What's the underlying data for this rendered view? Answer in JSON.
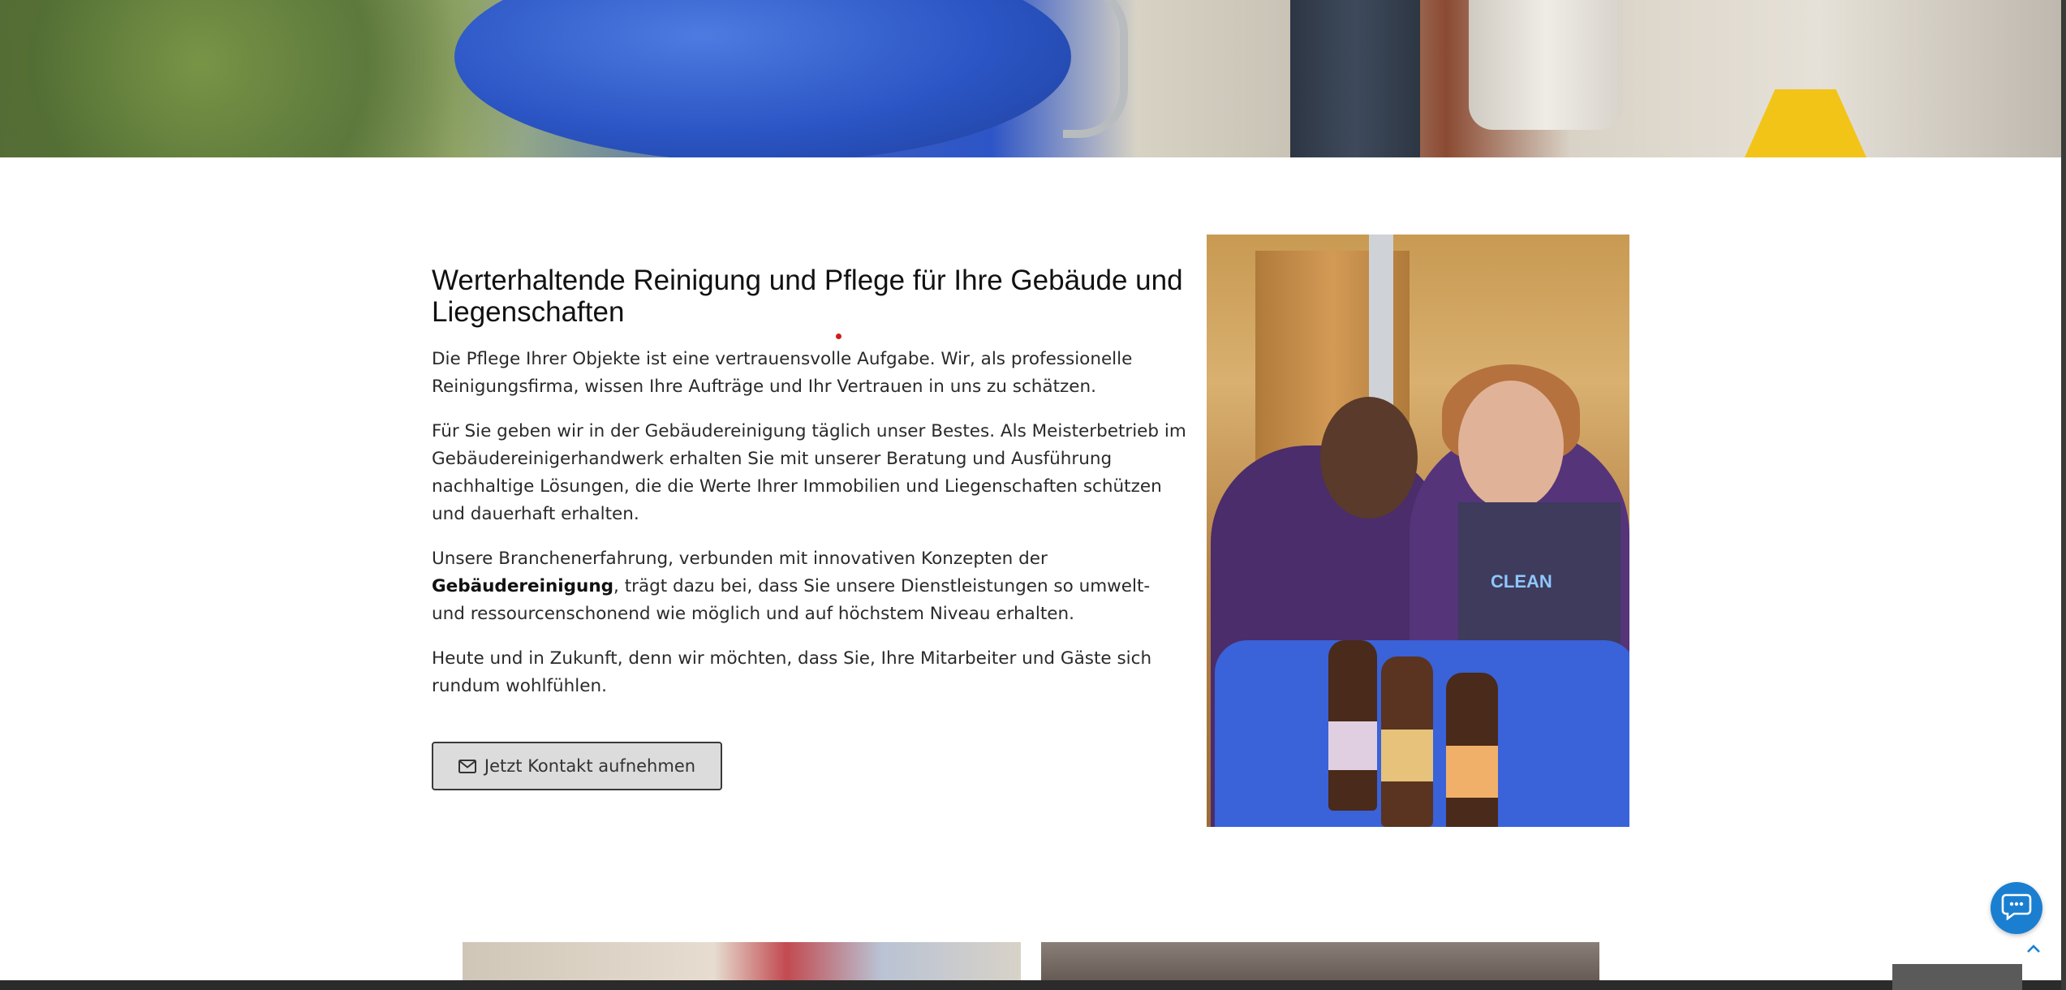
{
  "section": {
    "heading": "Werterhaltende Reinigung und Pflege für Ihre Gebäude und Liegenschaften",
    "paragraph1": "Die Pflege Ihrer Objekte ist eine vertrauensvolle Aufgabe. Wir, als professionelle Reinigungsfirma, wissen Ihre Aufträge und Ihr Vertrauen in uns zu schätzen.",
    "paragraph2": "Für Sie geben wir in der Gebäudereinigung täglich unser Bestes. Als Meisterbetrieb im Gebäudereinigerhandwerk erhalten Sie mit unserer Beratung und Ausführung nachhaltige Lösungen, die die Werte Ihrer Immobilien und Liegenschaften schützen und dauerhaft erhalten.",
    "paragraph3_before": "Unsere Branchenerfahrung, verbunden mit innovativen Konzepten der ",
    "paragraph3_bold": "Gebäudereinigung",
    "paragraph3_after": ", trägt dazu bei, dass Sie unsere Dienstleistungen so umwelt- und ressourcenschonend wie möglich und auf höchstem Niveau erhalten.",
    "paragraph4": "Heute und in Zukunft, denn wir möchten, dass Sie, Ihre Mitarbeiter und Gäste sich rundum wohlfühlen.",
    "cta_label": "Jetzt Kontakt aufnehmen",
    "cta_icon": "envelope-icon"
  },
  "photo": {
    "apron_logo": "CLEAN"
  },
  "widgets": {
    "chat_icon": "chat-bubble-icon",
    "scroll_top_icon": "chevron-up-icon",
    "chat_color": "#1a7fd0"
  }
}
